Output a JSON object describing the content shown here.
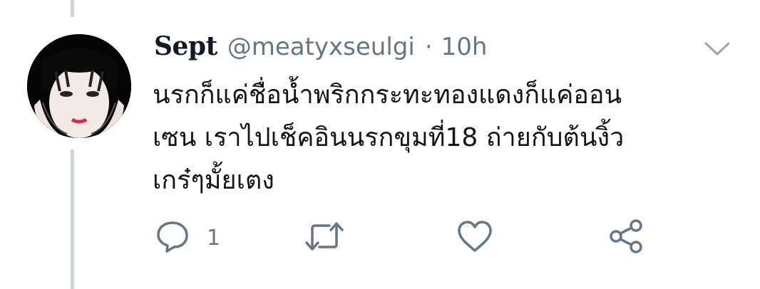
{
  "tweet": {
    "display_name": "Sept",
    "handle": "@meatyxseulgi",
    "separator": "·",
    "time": "10h",
    "text_lines": [
      "นรกก็แค่ชื่อน้ำพริกกระทะทองแดงก็แค่ออน",
      "เซน เราไปเช็คอินนรกขุมที่18 ถ่ายกับต้นงิ้ว",
      "เกร๋ๆมั้ยเตง"
    ],
    "reply_count": "1"
  },
  "icons": {
    "menu": "chevron-down-icon",
    "reply": "reply-icon",
    "retweet": "retweet-icon",
    "like": "heart-icon",
    "share": "share-icon"
  },
  "colors": {
    "text": "#14171a",
    "secondary": "#657786",
    "thread_line": "#cdd6dd"
  }
}
